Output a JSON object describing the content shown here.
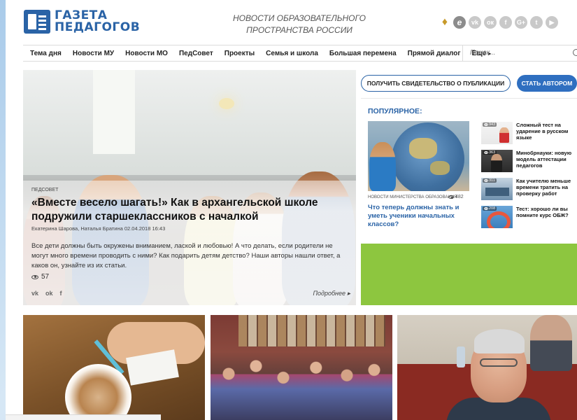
{
  "header": {
    "logo_line1": "ГАЗЕТА",
    "logo_line2": "ПЕДАГОГОВ",
    "tagline_line1": "НОВОСТИ ОБРАЗОВАТЕЛЬНОГО",
    "tagline_line2": "ПРОСТРАНСТВА РОССИИ",
    "social": [
      {
        "icon": "torch-icon",
        "glyph": "♦"
      },
      {
        "icon": "edu-icon",
        "glyph": "e"
      },
      {
        "icon": "vk-icon",
        "glyph": "vk"
      },
      {
        "icon": "ok-icon",
        "glyph": "ок"
      },
      {
        "icon": "facebook-icon",
        "glyph": "f"
      },
      {
        "icon": "google-plus-icon",
        "glyph": "G+"
      },
      {
        "icon": "twitter-icon",
        "glyph": "t"
      },
      {
        "icon": "youtube-icon",
        "glyph": "▶"
      }
    ]
  },
  "nav": {
    "items": [
      "Тема дня",
      "Новости МУ",
      "Новости МО",
      "ПедСовет",
      "Проекты",
      "Семья и школа",
      "Большая перемена",
      "Прямой диалог",
      "Еще"
    ],
    "more_caret": "▸",
    "search_placeholder": "Поиск..."
  },
  "hero": {
    "category": "ПЕДСОВЕТ",
    "title": "«Вместе весело шагать!» Как в архангельской школе подружили старшеклассников с началкой",
    "meta": "Екатерина Шарова, Наталья Братина 02.04.2018 16:43",
    "excerpt": "Все дети должны быть окружены вниманием, лаской и любовью! А что делать, если родители не могут много времени проводить с ними? Как подарить детям детство? Наши авторы нашли ответ, а каков он, узнайте из их статьи.",
    "views": "57",
    "share": [
      "vk",
      "ok",
      "f"
    ],
    "more_label": "Подробнее ▸"
  },
  "right": {
    "cert_button": "ПОЛУЧИТЬ СВИДЕТЕЛЬСТВО О ПУБЛИКАЦИИ",
    "author_button": "СТАТЬ АВТОРОМ",
    "popular_title": "ПОПУЛЯРНОЕ:",
    "main": {
      "category": "НОВОСТИ МИНИСТЕРСТВА ОБРАЗОВАНИЯ",
      "views": "482",
      "title": "Что теперь должны знать и уметь ученики начальных классов?"
    },
    "items": [
      {
        "views": "943",
        "title": "Сложный тест на ударение в русском языке"
      },
      {
        "views": "363",
        "title": "Минобрнауки: новую модель аттестации педагогов"
      },
      {
        "views": "311",
        "title": "Как учителю меньше времени тратить на проверку работ"
      },
      {
        "views": "208",
        "title": "Тест: хорошо ли вы помните курс ОБЖ?"
      }
    ]
  },
  "colors": {
    "brand_blue": "#2a63a6",
    "button_blue": "#2f6fc0",
    "green_block": "#8dc63f"
  }
}
